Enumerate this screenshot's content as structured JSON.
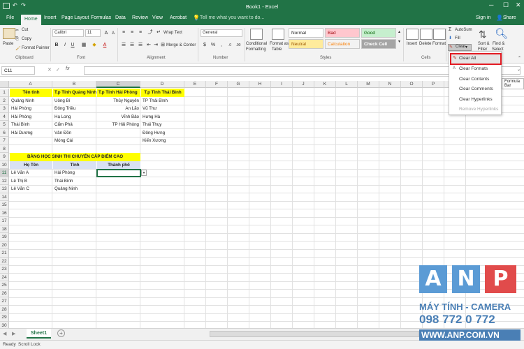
{
  "window": {
    "title": "Book1 - Excel"
  },
  "tabs": [
    "File",
    "Home",
    "Insert",
    "Page Layout",
    "Formulas",
    "Data",
    "Review",
    "View",
    "Acrobat"
  ],
  "tell_me": "Tell me what you want to do...",
  "account": {
    "sign_in": "Sign in",
    "share": "Share"
  },
  "clipboard": {
    "paste": "Paste",
    "cut": "Cut",
    "copy": "Copy",
    "format_painter": "Format Painter",
    "label": "Clipboard"
  },
  "font": {
    "name": "Calibri",
    "size": "11",
    "label": "Font"
  },
  "alignment": {
    "wrap": "Wrap Text",
    "merge": "Merge & Center",
    "label": "Alignment"
  },
  "number": {
    "format": "General",
    "label": "Number"
  },
  "styles": {
    "conditional_1": "Conditional",
    "conditional_2": "Formatting",
    "format_table_1": "Format as",
    "format_table_2": "Table",
    "normal": "Normal",
    "bad": "Bad",
    "good": "Good",
    "neutral": "Neutral",
    "calculation": "Calculation",
    "check_cell": "Check Cell",
    "label": "Styles"
  },
  "cells": {
    "insert": "Insert",
    "delete": "Delete",
    "format": "Format",
    "label": "Cells"
  },
  "editing": {
    "autosum": "AutoSum",
    "fill": "Fill",
    "clear": "Clear",
    "sort_1": "Sort &",
    "sort_2": "Filter",
    "find_1": "Find &",
    "find_2": "Select"
  },
  "clear_menu": {
    "items": [
      "Clear All",
      "Clear Formats",
      "Clear Contents",
      "Clear Comments",
      "Clear Hyperlinks",
      "Remove Hyperlinks"
    ]
  },
  "formula_bar": {
    "name_box": "C11",
    "fx": "fx",
    "tooltip": "Formula Bar"
  },
  "columns": [
    "A",
    "B",
    "C",
    "D",
    "E",
    "F",
    "G",
    "H",
    "I",
    "J",
    "K",
    "L",
    "M",
    "N",
    "O",
    "P",
    "Q"
  ],
  "rows": [
    "1",
    "2",
    "3",
    "4",
    "5",
    "6",
    "7",
    "8",
    "9",
    "10",
    "11",
    "12",
    "13",
    "14",
    "15",
    "16",
    "17",
    "18",
    "19",
    "20",
    "21",
    "22",
    "23",
    "24",
    "25",
    "26",
    "27",
    "28",
    "29",
    "30"
  ],
  "sheet": {
    "r1": {
      "a": "Tên tỉnh",
      "b": "T.p Tỉnh Quảng Ninh",
      "c": "T.p Tỉnh Hải Phòng",
      "d": "T.p Tỉnh Thái Bình"
    },
    "r2": {
      "a": "Quảng Ninh",
      "b": "Uông Bí",
      "c": "Thủy Nguyên",
      "d": "TP Thái Bình"
    },
    "r3": {
      "a": "Hải Phòng",
      "b": "Đông Triều",
      "c": "An Lão",
      "d": "Vũ Thư"
    },
    "r4": {
      "a": "Hải Phòng",
      "b": "Hạ Long",
      "c": "Vĩnh Bảo",
      "d": "Hưng Hà"
    },
    "r5": {
      "a": "Thái Bình",
      "b": "Cẩm Phả",
      "c": "TP Hải Phòng",
      "d": "Thái Thụy"
    },
    "r6": {
      "a": "Hải Dương",
      "b": "Vân Đồn",
      "d": "Đông Hưng"
    },
    "r7": {
      "b": "Móng Cái",
      "d": "Kiến Xương"
    },
    "r9": {
      "title": "BẢNG HỌC SINH THI CHUYỂN CẤP ĐIỂM CAO"
    },
    "r10": {
      "a": "Họ Tên",
      "b": "Tỉnh",
      "c": "Thành phố"
    },
    "r11": {
      "a": "Lê Văn A",
      "b": "Hải Phòng"
    },
    "r12": {
      "a": "Lê Thị B",
      "b": "Thái Bình"
    },
    "r13": {
      "a": "Lê Văn C",
      "b": "Quảng Ninh"
    }
  },
  "sheet_tab": "Sheet1",
  "status": {
    "ready": "Ready",
    "scroll_lock": "Scroll Lock"
  },
  "watermark": {
    "letters": [
      "A",
      "N",
      "P"
    ],
    "line1": "MÁY TÍNH - CAMERA",
    "line2": "098 772 0 772",
    "line3": "WWW.ANP.COM.VN"
  },
  "colors": {
    "excel_green": "#217346",
    "yellow": "#ffff00",
    "highlight": "#e31b23",
    "anp_blue": "#5b9bd5",
    "anp_red": "#e14b4b"
  }
}
